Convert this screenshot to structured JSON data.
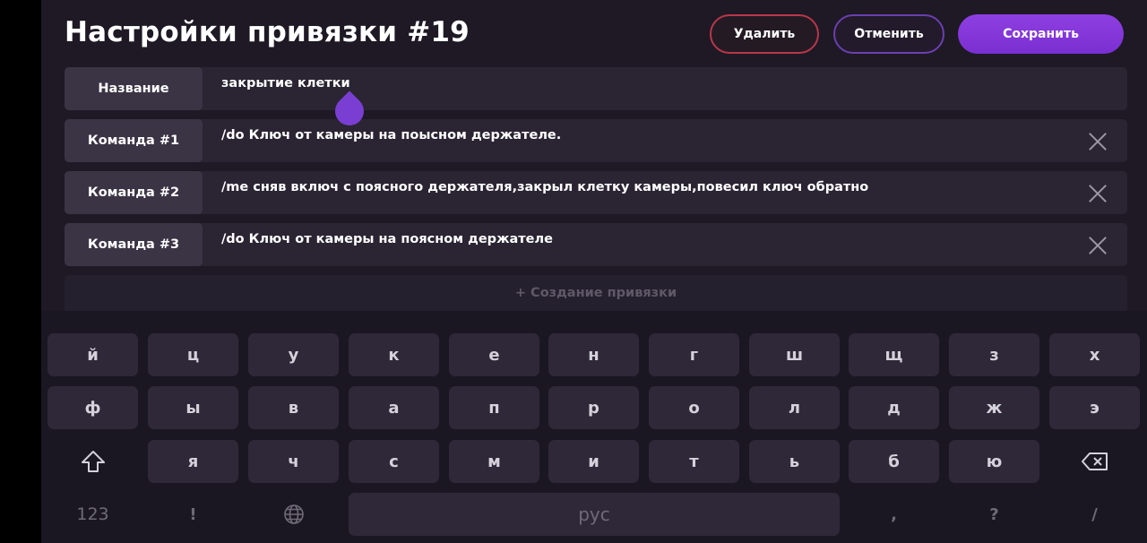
{
  "header": {
    "title": "Настройки привязки #19",
    "delete_label": "Удалить",
    "cancel_label": "Отменить",
    "save_label": "Сохранить"
  },
  "rows": [
    {
      "label": "Название",
      "value": "закрытие клетки",
      "removable": false
    },
    {
      "label": "Команда #1",
      "value": "/do Ключ от камеры на поысном держателе.",
      "removable": true
    },
    {
      "label": "Команда #2",
      "value": "/me сняв включ с поясного держателя,закрыл клетку камеры,повесил ключ обратно",
      "removable": true
    },
    {
      "label": "Команда #3",
      "value": "/do Ключ от камеры на поясном держателе",
      "removable": true
    }
  ],
  "create_label": "+ Создание привязки",
  "keyboard": {
    "row1": [
      "й",
      "ц",
      "у",
      "к",
      "е",
      "н",
      "г",
      "ш",
      "щ",
      "з",
      "х"
    ],
    "row2": [
      "ф",
      "ы",
      "в",
      "а",
      "п",
      "р",
      "о",
      "л",
      "д",
      "ж",
      "э"
    ],
    "row3": [
      "я",
      "ч",
      "с",
      "м",
      "и",
      "т",
      "ь",
      "б",
      "ю"
    ],
    "shift_icon": "shift-icon",
    "backspace_icon": "backspace-icon",
    "numbers_label": "123",
    "exclamation_label": "!",
    "globe_icon": "globe-icon",
    "space_label": "рус",
    "comma_label": ",",
    "question_label": "?",
    "slash_label": "/"
  },
  "colors": {
    "accent": "#8f3fe0",
    "danger": "#b8374a",
    "background": "#1e1925"
  }
}
